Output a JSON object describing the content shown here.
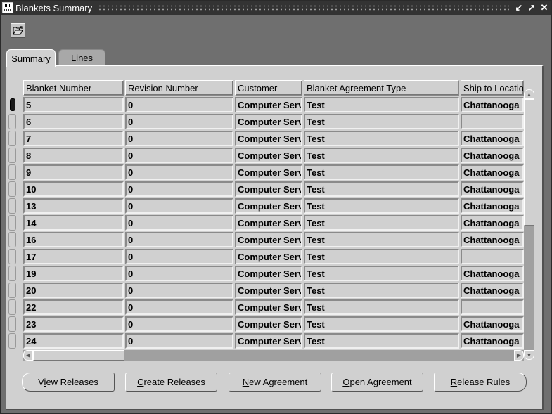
{
  "window": {
    "title": "Blankets Summary",
    "controls": [
      "minimize",
      "maximize",
      "close"
    ]
  },
  "toolbar": {
    "open_icon": "open-folder-icon"
  },
  "tabs": [
    {
      "label": "Summary",
      "active": true
    },
    {
      "label": "Lines",
      "active": false
    }
  ],
  "table": {
    "columns": [
      "Blanket Number",
      "Revision Number",
      "Customer",
      "Blanket Agreement Type",
      "Ship to Locatio"
    ],
    "rows": [
      {
        "blanket_number": "5",
        "revision": "0",
        "customer": "Computer Serv",
        "type": "Test",
        "ship_to": "Chattanooga",
        "current": true
      },
      {
        "blanket_number": "6",
        "revision": "0",
        "customer": "Computer Serv",
        "type": "Test",
        "ship_to": ""
      },
      {
        "blanket_number": "7",
        "revision": "0",
        "customer": "Computer Serv",
        "type": "Test",
        "ship_to": "Chattanooga"
      },
      {
        "blanket_number": "8",
        "revision": "0",
        "customer": "Computer Serv",
        "type": "Test",
        "ship_to": "Chattanooga"
      },
      {
        "blanket_number": "9",
        "revision": "0",
        "customer": "Computer Serv",
        "type": "Test",
        "ship_to": "Chattanooga"
      },
      {
        "blanket_number": "10",
        "revision": "0",
        "customer": "Computer Serv",
        "type": "Test",
        "ship_to": "Chattanooga"
      },
      {
        "blanket_number": "13",
        "revision": "0",
        "customer": "Computer Serv",
        "type": "Test",
        "ship_to": "Chattanooga"
      },
      {
        "blanket_number": "14",
        "revision": "0",
        "customer": "Computer Serv",
        "type": "Test",
        "ship_to": "Chattanooga"
      },
      {
        "blanket_number": "16",
        "revision": "0",
        "customer": "Computer Serv",
        "type": "Test",
        "ship_to": "Chattanooga"
      },
      {
        "blanket_number": "17",
        "revision": "0",
        "customer": "Computer Serv",
        "type": "Test",
        "ship_to": ""
      },
      {
        "blanket_number": "19",
        "revision": "0",
        "customer": "Computer Serv",
        "type": "Test",
        "ship_to": "Chattanooga"
      },
      {
        "blanket_number": "20",
        "revision": "0",
        "customer": "Computer Serv",
        "type": "Test",
        "ship_to": "Chattanooga"
      },
      {
        "blanket_number": "22",
        "revision": "0",
        "customer": "Computer Serv",
        "type": "Test",
        "ship_to": ""
      },
      {
        "blanket_number": "23",
        "revision": "0",
        "customer": "Computer Serv",
        "type": "Test",
        "ship_to": "Chattanooga"
      },
      {
        "blanket_number": "24",
        "revision": "0",
        "customer": "Computer Serv",
        "type": "Test",
        "ship_to": "Chattanooga"
      }
    ]
  },
  "buttons": [
    {
      "label": "View Releases",
      "mnemonic_index": 1
    },
    {
      "label": "Create Releases",
      "mnemonic_index": 0
    },
    {
      "label": "New Agreement",
      "mnemonic_index": 0
    },
    {
      "label": "Open Agreement",
      "mnemonic_index": 0
    },
    {
      "label": "Release Rules",
      "mnemonic_index": 0
    }
  ]
}
